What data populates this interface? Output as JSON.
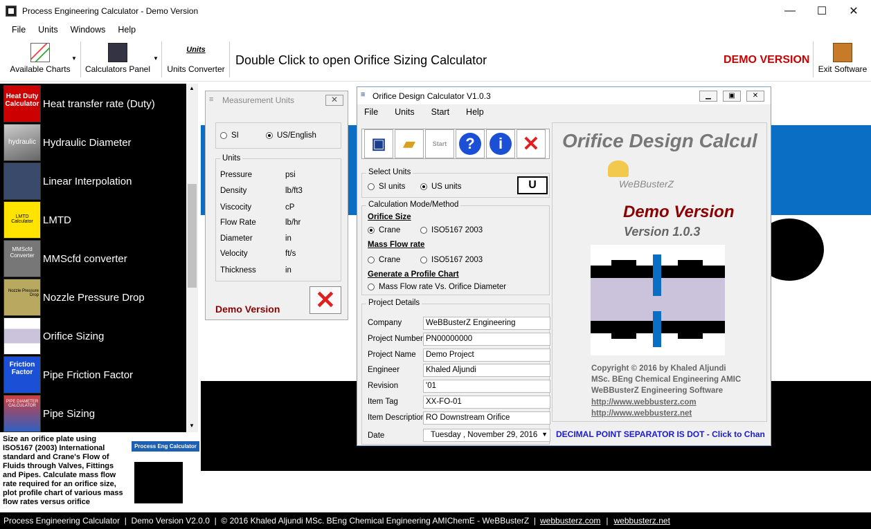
{
  "window": {
    "title": "Process Engineering Calculator - Demo Version",
    "min": "—",
    "max": "☐",
    "close": "✕"
  },
  "menu": [
    "File",
    "Units",
    "Windows",
    "Help"
  ],
  "toolbar": {
    "available_charts": "Available Charts",
    "calculators_panel": "Calculators Panel",
    "units_converter": "Units Converter",
    "hint": "Double Click to open Orifice Sizing Calculator",
    "demo": "DEMO VERSION",
    "exit": "Exit Software",
    "units_icon_text": "Units"
  },
  "sidebar": {
    "items": [
      {
        "label": "Heat transfer rate (Duty)",
        "thumb": "Heat Duty Calculator"
      },
      {
        "label": "Hydraulic Diameter",
        "thumb": "hydraulic"
      },
      {
        "label": "Linear Interpolation",
        "thumb": ""
      },
      {
        "label": "LMTD",
        "thumb": "LMTD Calculator"
      },
      {
        "label": "MMScfd converter",
        "thumb": "MMScfd Converter"
      },
      {
        "label": "Nozzle Pressure Drop",
        "thumb": "Nozzle Pressure Drop"
      },
      {
        "label": "Orifice Sizing",
        "thumb": ""
      },
      {
        "label": "Pipe Friction Factor",
        "thumb": "Friction Factor"
      },
      {
        "label": "Pipe Sizing",
        "thumb": "PIPE DIAMETER CALCULATOR"
      }
    ],
    "description": "Size an orifice plate using ISO5167 (2003) International standard and Crane's Flow of Fluids through Valves, Fittings and Pipes. Calculate mass flow rate required for an orifice size, plot profile chart of various mass flow rates versus orifice",
    "logo_text": "Process Eng Calculator"
  },
  "status": {
    "text": "Process Engineering Calculator  |  Demo Version V2.0.0  |  © 2016 Khaled Aljundi MSc. BEng Chemical Engineering AMIChemE - WeBBusterZ  |",
    "link1": "webbusterz.com",
    "sep": "|",
    "link2": "webbusterz.net"
  },
  "measurement": {
    "title": "Measurement Units",
    "si": "SI",
    "us": "US/English",
    "units_group": "Units",
    "rows": [
      {
        "name": "Pressure",
        "unit": "psi"
      },
      {
        "name": "Density",
        "unit": "lb/ft3"
      },
      {
        "name": "Viscocity",
        "unit": "cP"
      },
      {
        "name": "Flow Rate",
        "unit": "lb/hr"
      },
      {
        "name": "Diameter",
        "unit": "in"
      },
      {
        "name": "Velocity",
        "unit": "ft/s"
      },
      {
        "name": "Thickness",
        "unit": "in"
      }
    ],
    "demo": "Demo Version"
  },
  "orifice": {
    "title": "Orifice Design Calculator V1.0.3",
    "menu": [
      "File",
      "Units",
      "Start",
      "Help"
    ],
    "start_label": "Start",
    "select_units": "Select Units",
    "si_units": "SI units",
    "us_units": "US units",
    "u_button": "U",
    "calc_mode": "Calculation Mode/Method",
    "orifice_size": "Orifice Size",
    "crane": "Crane",
    "iso": "ISO5167 2003",
    "mass_flow": "Mass Flow rate",
    "profile_chart": "Generate a Profile Chart",
    "mass_vs": "Mass Flow rate Vs. Orifice Diameter",
    "project_details": "Project Details",
    "fields": [
      {
        "label": "Company",
        "value": "WeBBusterZ Engineering"
      },
      {
        "label": "Project Number",
        "value": "PN00000000"
      },
      {
        "label": "Project Name",
        "value": "Demo Project"
      },
      {
        "label": "Engineer",
        "value": "Khaled Aljundi"
      },
      {
        "label": "Revision",
        "value": "'01"
      },
      {
        "label": "Item Tag",
        "value": "XX-FO-01"
      },
      {
        "label": "Item Description",
        "value": "RO Downstream Orifice"
      }
    ],
    "date_label": "Date",
    "date_value": "Tuesday  ,  November 29, 2016",
    "info": {
      "heading": "Orifice Design Calcul",
      "brand": "WeBBusterZ",
      "demo": "Demo Version",
      "version": "Version 1.0.3",
      "copyright": "Copyright © 2016 by Khaled Aljundi",
      "msc": "MSc. BEng Chemical Engineering AMIC",
      "software": "WeBBusterZ Engineering Software",
      "link1": "http://www.webbusterz.com",
      "link2": "http://www.webbusterz.net"
    },
    "decimal_note": "DECIMAL POINT SEPARATOR IS DOT - Click to Chan"
  }
}
